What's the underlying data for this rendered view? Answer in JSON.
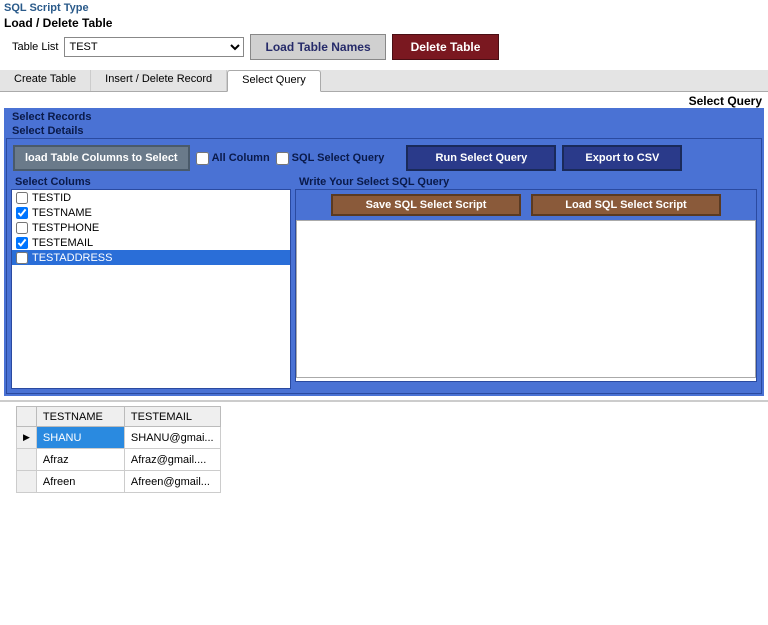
{
  "header": {
    "sql_script_type": "SQL Script Type",
    "load_delete_title": "Load / Delete Table",
    "table_list_label": "Table List",
    "table_list_value": "TEST",
    "load_table_names": "Load Table Names",
    "delete_table": "Delete Table"
  },
  "tabs": {
    "create": "Create Table",
    "insert": "Insert / Delete Record",
    "select": "Select Query"
  },
  "select_query_label_right": "Select Query",
  "panel": {
    "select_records": "Select Records",
    "select_details": "Select Details",
    "load_columns_btn": "load Table Columns to Select",
    "all_column": "All Column",
    "sql_select_query_chk": "SQL Select Query",
    "run_select_query": "Run Select Query",
    "export_csv": "Export to CSV",
    "select_columns_title": "Select Colums",
    "write_sql_title": "Write Your Select SQL Query",
    "save_script": "Save SQL Select Script",
    "load_script": "Load SQL Select Script"
  },
  "columns": [
    {
      "name": "TESTID",
      "checked": false,
      "selected": false
    },
    {
      "name": "TESTNAME",
      "checked": true,
      "selected": false
    },
    {
      "name": "TESTPHONE",
      "checked": false,
      "selected": false
    },
    {
      "name": "TESTEMAIL",
      "checked": true,
      "selected": false
    },
    {
      "name": "TESTADDRESS",
      "checked": false,
      "selected": true
    }
  ],
  "sql_text": "",
  "results": {
    "headers": [
      "TESTNAME",
      "TESTEMAIL"
    ],
    "rows": [
      {
        "name": "SHANU",
        "email": "SHANU@gmai...",
        "selected": true,
        "indicator": "▶"
      },
      {
        "name": "Afraz",
        "email": "Afraz@gmail....",
        "selected": false,
        "indicator": ""
      },
      {
        "name": "Afreen",
        "email": "Afreen@gmail...",
        "selected": false,
        "indicator": ""
      }
    ]
  }
}
